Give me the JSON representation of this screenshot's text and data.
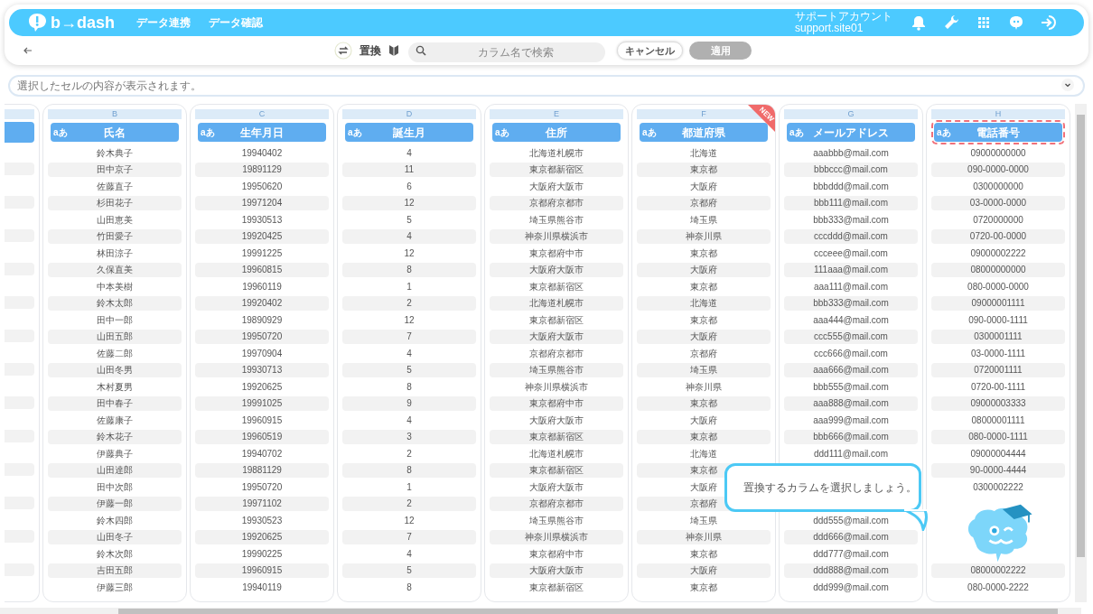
{
  "header": {
    "logo": "b→dash",
    "nav": [
      "データ連携",
      "データ確認"
    ],
    "account": {
      "name": "サポートアカウント",
      "id": "support.site01"
    }
  },
  "toolbar": {
    "mode_label": "置換",
    "search": {
      "placeholder": "カラム名で検索"
    },
    "buttons": [
      {
        "label": "キャンセル",
        "disabled": false
      },
      {
        "label": "適用",
        "disabled": true
      }
    ]
  },
  "cell_preview": {
    "placeholder": "選択したセルの内容が表示されます。"
  },
  "columns": [
    {
      "letter": "B",
      "type_label": "aあ",
      "title": "氏名",
      "selected": false
    },
    {
      "letter": "C",
      "type_label": "aあ",
      "title": "生年月日",
      "selected": false
    },
    {
      "letter": "D",
      "type_label": "aあ",
      "title": "誕生月",
      "selected": false
    },
    {
      "letter": "E",
      "type_label": "aあ",
      "title": "住所",
      "selected": false
    },
    {
      "letter": "F",
      "type_label": "aあ",
      "title": "都道府県",
      "selected": false,
      "badge": "NEW"
    },
    {
      "letter": "G",
      "type_label": "aあ",
      "title": "メールアドレス",
      "selected": false
    },
    {
      "letter": "H",
      "type_label": "aあ",
      "title": "電話番号",
      "selected": true
    }
  ],
  "rows": [
    [
      "鈴木典子",
      "19940402",
      "4",
      "北海道札幌市",
      "北海道",
      "aaabbb@mail.com",
      "09000000000"
    ],
    [
      "田中京子",
      "19891129",
      "11",
      "東京都新宿区",
      "東京都",
      "bbbccc@mail.com",
      "090-0000-0000"
    ],
    [
      "佐藤直子",
      "19950620",
      "6",
      "大阪府大阪市",
      "大阪府",
      "bbbddd@mail.com",
      "0300000000"
    ],
    [
      "杉田花子",
      "19971204",
      "12",
      "京都府京都市",
      "京都府",
      "bbb111@mail.com",
      "03-0000-0000"
    ],
    [
      "山田恵美",
      "19930513",
      "5",
      "埼玉県熊谷市",
      "埼玉県",
      "bbb333@mail.com",
      "0720000000"
    ],
    [
      "竹田愛子",
      "19920425",
      "4",
      "神奈川県横浜市",
      "神奈川県",
      "cccddd@mail.com",
      "0720-00-0000"
    ],
    [
      "林田涼子",
      "19991225",
      "12",
      "東京都府中市",
      "東京都",
      "ccceee@mail.com",
      "09000002222"
    ],
    [
      "久保直美",
      "19960815",
      "8",
      "大阪府大阪市",
      "大阪府",
      "111aaa@mail.com",
      "08000000000"
    ],
    [
      "中本美樹",
      "19960119",
      "1",
      "東京都新宿区",
      "東京都",
      "aaa111@mail.com",
      "080-0000-0000"
    ],
    [
      "鈴木太郎",
      "19920402",
      "2",
      "北海道札幌市",
      "北海道",
      "bbb333@mail.com",
      "09000001111"
    ],
    [
      "田中一郎",
      "19890929",
      "12",
      "東京都新宿区",
      "東京都",
      "aaa444@mail.com",
      "090-0000-1111"
    ],
    [
      "山田五郎",
      "19950720",
      "7",
      "大阪府大阪市",
      "大阪府",
      "ccc555@mail.com",
      "0300001111"
    ],
    [
      "佐藤二郎",
      "19970904",
      "4",
      "京都府京都市",
      "京都府",
      "ccc666@mail.com",
      "03-0000-1111"
    ],
    [
      "山田冬男",
      "19930713",
      "5",
      "埼玉県熊谷市",
      "埼玉県",
      "aaa666@mail.com",
      "0720001111"
    ],
    [
      "木村夏男",
      "19920625",
      "8",
      "神奈川県横浜市",
      "神奈川県",
      "bbb555@mail.com",
      "0720-00-1111"
    ],
    [
      "田中春子",
      "19991025",
      "9",
      "東京都府中市",
      "東京都",
      "aaa888@mail.com",
      "09000003333"
    ],
    [
      "佐藤康子",
      "19960915",
      "4",
      "大阪府大阪市",
      "大阪府",
      "aaa999@mail.com",
      "08000001111"
    ],
    [
      "鈴木花子",
      "19960519",
      "3",
      "東京都新宿区",
      "東京都",
      "bbb666@mail.com",
      "080-0000-1111"
    ],
    [
      "伊藤典子",
      "19940702",
      "2",
      "北海道札幌市",
      "北海道",
      "ddd111@mail.com",
      "09000004444"
    ],
    [
      "山田達郎",
      "19881129",
      "8",
      "東京都新宿区",
      "東京都",
      null,
      "90-0000-4444"
    ],
    [
      "田中次郎",
      "19950720",
      "1",
      "大阪府大阪市",
      "大阪府",
      null,
      "0300002222"
    ],
    [
      "伊藤一郎",
      "19971102",
      "2",
      "京都府京都市",
      "京都府",
      null,
      null
    ],
    [
      "鈴木四郎",
      "19930523",
      "12",
      "埼玉県熊谷市",
      "埼玉県",
      "ddd555@mail.com",
      null
    ],
    [
      "山田冬子",
      "19920625",
      "7",
      "神奈川県横浜市",
      "神奈川県",
      "ddd666@mail.com",
      null
    ],
    [
      "鈴木次郎",
      "19990225",
      "4",
      "東京都府中市",
      "東京都",
      "ddd777@mail.com",
      null
    ],
    [
      "吉田五郎",
      "19960915",
      "5",
      "大阪府大阪市",
      "大阪府",
      "ddd888@mail.com",
      "08000002222"
    ],
    [
      "伊藤三郎",
      "19940119",
      "8",
      "東京都新宿区",
      "東京都",
      "ddd999@mail.com",
      "080-0000-2222"
    ]
  ],
  "tooltip": {
    "text": "置換するカラムを選択しましょう。"
  }
}
